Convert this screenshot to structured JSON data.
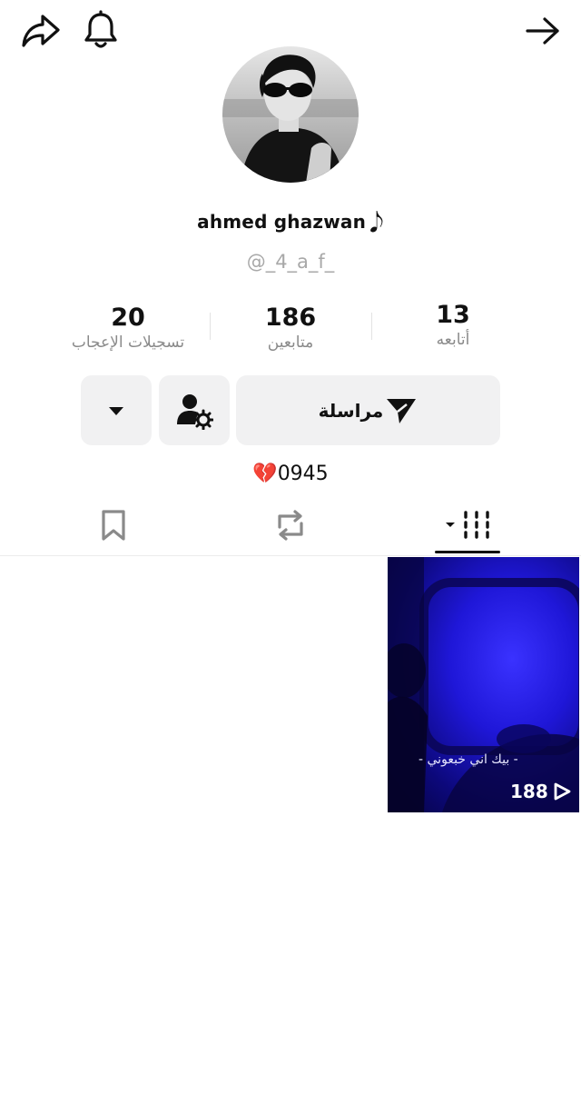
{
  "profile": {
    "display_name": "ahmed ghazwan",
    "name_emoji": "𝅘𝅥𝅮",
    "username": "@_4_a_f_",
    "bio": "💔0945"
  },
  "stats": {
    "following": {
      "value": "13",
      "label": "أتابعه"
    },
    "followers": {
      "value": "186",
      "label": "متابعين"
    },
    "likes": {
      "value": "20",
      "label": "تسجيلات الإعجاب"
    }
  },
  "actions": {
    "message_label": "مراسلة"
  },
  "icons": {
    "share": "share-icon",
    "notifications": "bell-icon",
    "back": "arrow-right-icon",
    "message": "send-icon",
    "manage": "user-gear-icon",
    "more": "caret-down-icon",
    "saved": "bookmark-icon",
    "reposts": "repost-icon",
    "videos": "grid-icon"
  },
  "videos": [
    {
      "views": "188",
      "caption": "- بيك اني خبعوني -"
    }
  ],
  "colors": {
    "button_bg": "#f1f1f2",
    "secondary_text": "#8a8a8a",
    "video_tint": "#1f17d8"
  }
}
